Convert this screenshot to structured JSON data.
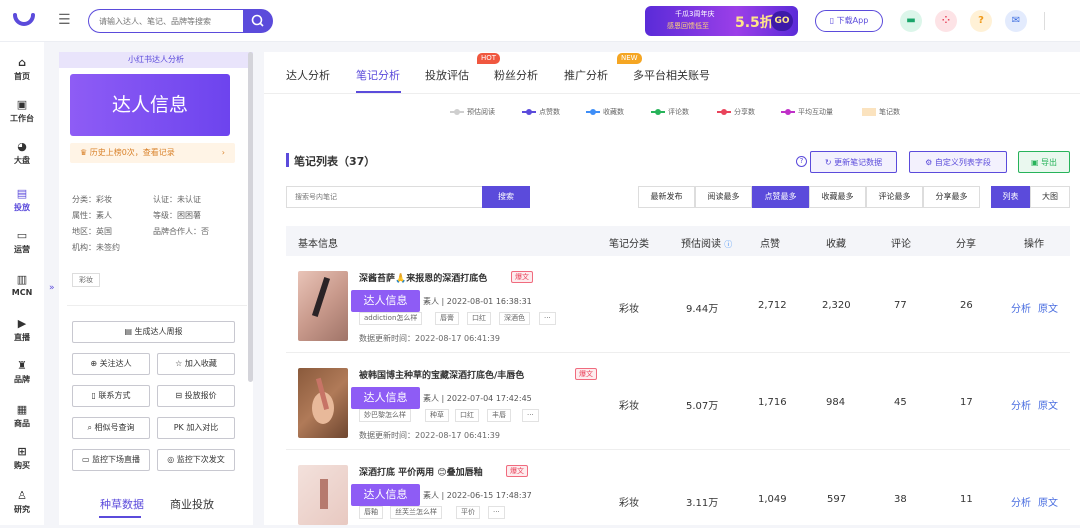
{
  "topbar": {
    "search_placeholder": "请输入达人、笔记、品牌等搜索",
    "banner_line1": "千瓜3周年庆",
    "banner_line2": "感恩回馈低至",
    "banner_discount": "5.5折",
    "banner_go": "GO",
    "download_label": "下载App",
    "help_label": "?"
  },
  "leftnav": [
    {
      "label": "首页",
      "icon": "home-icon"
    },
    {
      "label": "工作台",
      "icon": "workbench-icon"
    },
    {
      "label": "大盘",
      "icon": "pie-icon"
    },
    {
      "label": "投放",
      "icon": "delivery-icon",
      "active": true
    },
    {
      "label": "运营",
      "icon": "chat-icon"
    },
    {
      "label": "MCN",
      "icon": "mcn-icon"
    },
    {
      "label": "直播",
      "icon": "live-icon"
    },
    {
      "label": "品牌",
      "icon": "brand-icon"
    },
    {
      "label": "商品",
      "icon": "goods-icon"
    },
    {
      "label": "购买",
      "icon": "cart-icon"
    },
    {
      "label": "研究",
      "icon": "research-icon"
    }
  ],
  "profile": {
    "header": "小红书达人分析",
    "card_title": "达人信息",
    "history": "历史上榜0次，查看记录",
    "info": {
      "category": "分类：彩妆",
      "verified": "认证：未认证",
      "attribute": "属性：素人",
      "level": "等级：困困薯",
      "region": "地区：英国",
      "brand_partner": "品牌合作人：否",
      "org": "机构：未签约"
    },
    "tag": "彩妆",
    "buttons": {
      "weekly": "生成达人周报",
      "follow": "关注达人",
      "collect": "加入收藏",
      "contact": "联系方式",
      "quote": "投放报价",
      "similar": "相似号查询",
      "compare": "加入对比",
      "monitor_live": "监控下场直播",
      "monitor_post": "监控下次发文"
    },
    "tabs": [
      "种草数据",
      "商业投放"
    ]
  },
  "main": {
    "tabs": [
      "达人分析",
      "笔记分析",
      "投放评估",
      "粉丝分析",
      "推广分析",
      "多平台相关账号"
    ],
    "hot_badge": "HOT",
    "new_badge": "NEW",
    "legend": [
      {
        "label": "预估阅读",
        "color": "#cfcfcf"
      },
      {
        "label": "点赞数",
        "color": "#5b4bdb"
      },
      {
        "label": "收藏数",
        "color": "#3e8ef7"
      },
      {
        "label": "评论数",
        "color": "#27b35a"
      },
      {
        "label": "分享数",
        "color": "#e9435b"
      },
      {
        "label": "平均互动量",
        "color": "#c030c8"
      },
      {
        "label": "笔记数",
        "color": "#fbe3bf"
      }
    ],
    "list_title": "笔记列表（37）",
    "update_btn": "更新笔记数据",
    "custom_btn": "自定义列表字段",
    "export_btn": "导出",
    "search_placeholder": "搜索号内笔记",
    "search_btn": "搜索",
    "sorts": [
      "最新发布",
      "阅读最多",
      "点赞最多",
      "收藏最多",
      "评论最多",
      "分享最多"
    ],
    "views": [
      "列表",
      "大图"
    ],
    "columns": [
      "基本信息",
      "笔记分类",
      "预估阅读",
      "点赞",
      "收藏",
      "评论",
      "分享",
      "操作"
    ],
    "notes": [
      {
        "title": "深酱苔萨🙏来报恩的深酒打底色",
        "tag": "爆文",
        "profile_btn": "达人信息",
        "meta": "素人 | 2022-08-01 16:38:31",
        "keywords": [
          "addiction怎么样",
          "唇膏",
          "口红",
          "深酒色",
          "···"
        ],
        "updated": "数据更新时间：2022-08-17 06:41:39",
        "category": "彩妆",
        "reads": "9.44万",
        "likes": "2,712",
        "collects": "2,320",
        "comments": "77",
        "shares": "26",
        "action_analysis": "分析",
        "action_source": "原文"
      },
      {
        "title": "被韩国博主种草的宝藏深酒打底色/丰唇色",
        "tag": "爆文",
        "profile_btn": "达人信息",
        "meta": "素人 | 2022-07-04 17:42:45",
        "keywords": [
          "妙巴黎怎么样",
          "种草",
          "口红",
          "丰唇",
          "···"
        ],
        "updated": "数据更新时间：2022-08-17 06:41:39",
        "category": "彩妆",
        "reads": "5.07万",
        "likes": "1,716",
        "collects": "984",
        "comments": "45",
        "shares": "17",
        "action_analysis": "分析",
        "action_source": "原文"
      },
      {
        "title": "深酒打底 平价两用 😊叠加唇釉",
        "tag": "爆文",
        "profile_btn": "达人信息",
        "meta": "素人 | 2022-06-15 17:48:37",
        "keywords": [
          "唇釉",
          "丝芙兰怎么样",
          "平价",
          "···"
        ],
        "updated": "",
        "category": "彩妆",
        "reads": "3.11万",
        "likes": "1,049",
        "collects": "597",
        "comments": "38",
        "shares": "11",
        "action_analysis": "分析",
        "action_source": "原文"
      }
    ]
  }
}
